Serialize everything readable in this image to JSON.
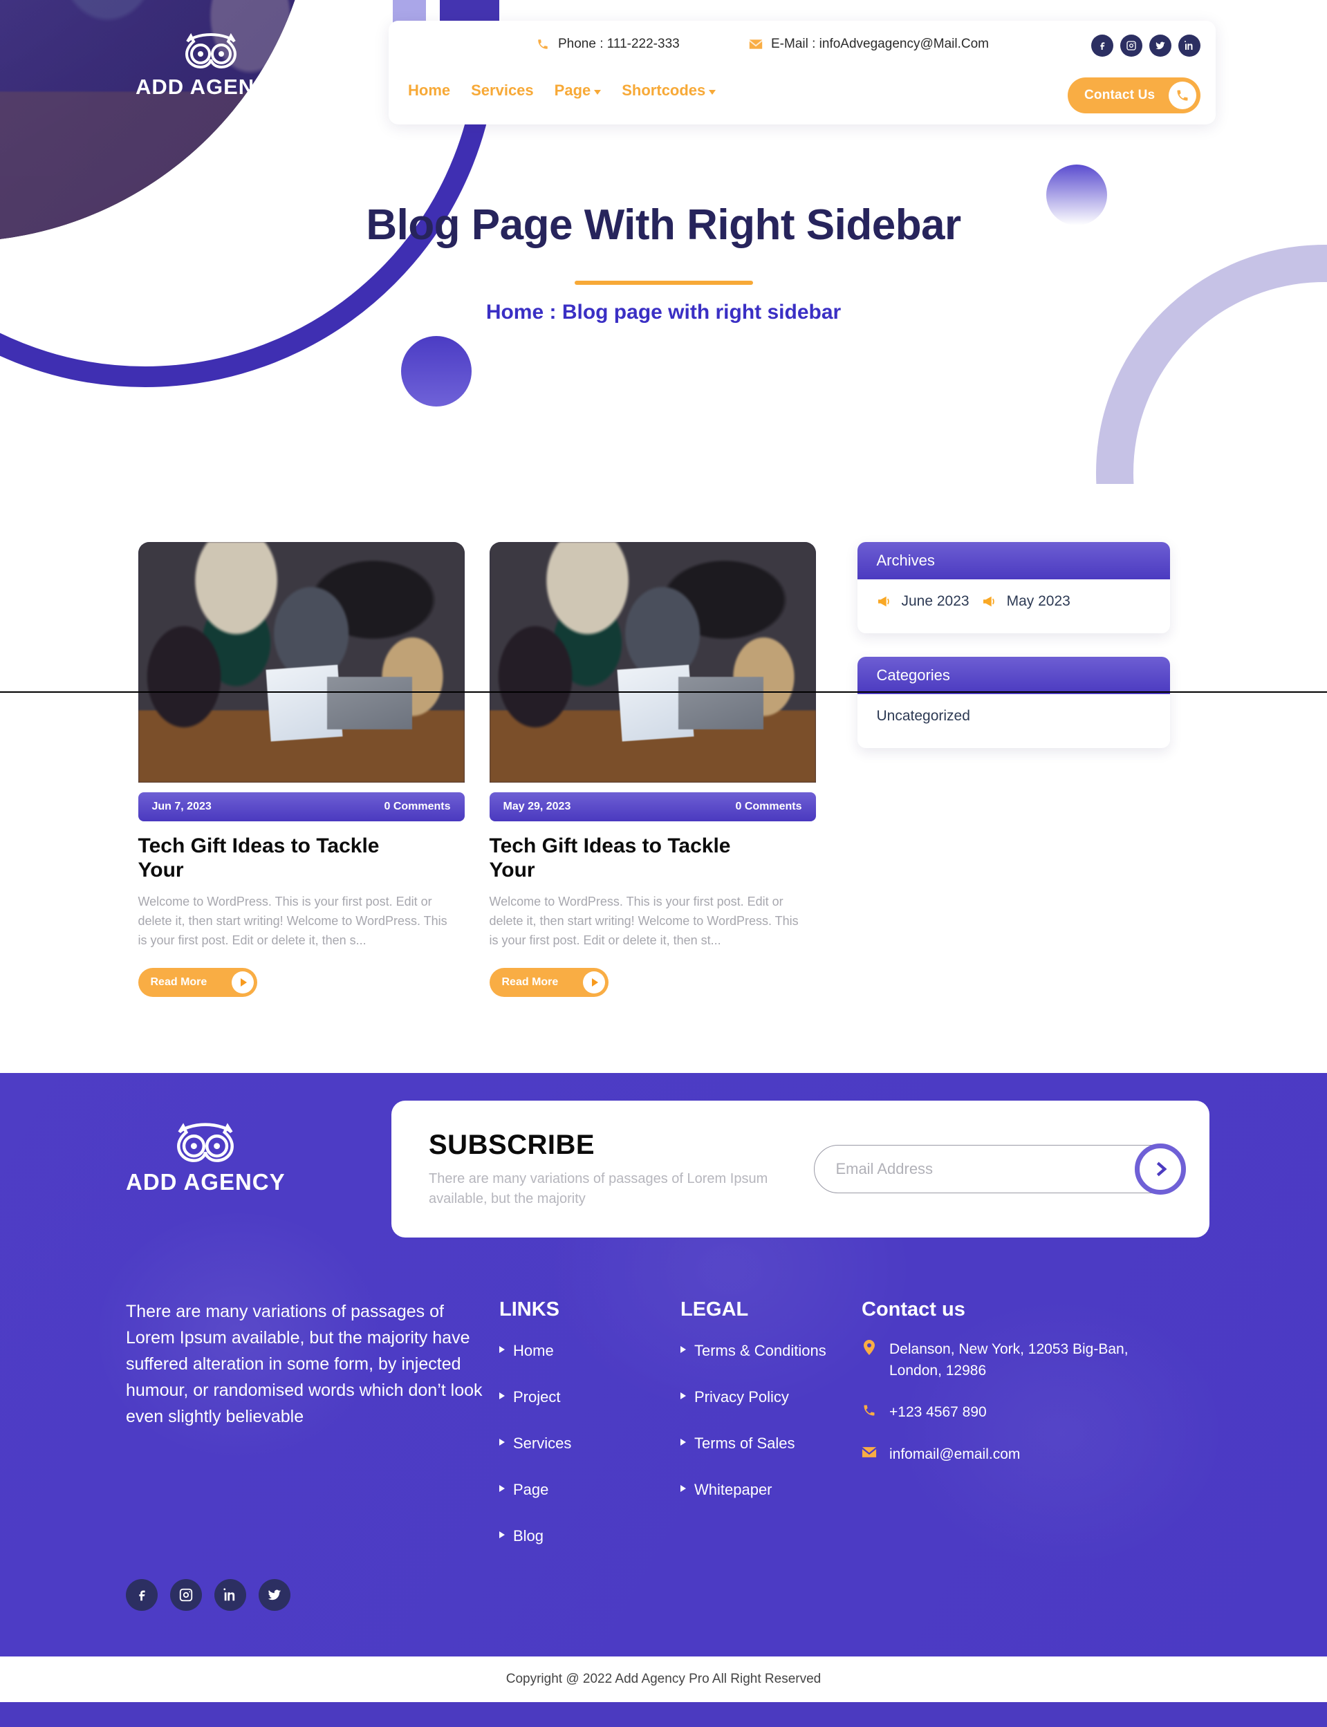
{
  "brand": {
    "name": "ADD AGENCY",
    "logo_icon": "owl-icon"
  },
  "topbar": {
    "phone_label": "Phone : 111-222-333",
    "email_label": "E-Mail : infoAdvegagency@Mail.Com",
    "phone_icon": "phone-icon",
    "email_icon": "envelope-icon",
    "socials": [
      {
        "name": "facebook-icon"
      },
      {
        "name": "instagram-icon"
      },
      {
        "name": "twitter-icon"
      },
      {
        "name": "linkedin-icon"
      }
    ]
  },
  "nav": {
    "items": [
      {
        "label": "Home",
        "has_dropdown": false
      },
      {
        "label": "Services",
        "has_dropdown": false
      },
      {
        "label": "Page",
        "has_dropdown": true
      },
      {
        "label": "Shortcodes",
        "has_dropdown": true
      }
    ],
    "contact_button": {
      "label": "Contact Us",
      "icon": "phone-icon"
    }
  },
  "hero": {
    "title": "Blog Page With Right Sidebar",
    "breadcrumb": "Home : Blog page with right sidebar"
  },
  "posts": [
    {
      "date": "Jun 7, 2023",
      "comments": "0 Comments",
      "title": "Tech Gift Ideas to Tackle Your",
      "excerpt": "Welcome to WordPress. This is your first post. Edit or delete it, then start writing! Welcome to WordPress. This is your first post. Edit or delete it, then s...",
      "read_more": "Read More"
    },
    {
      "date": "May 29, 2023",
      "comments": "0 Comments",
      "title": "Tech Gift Ideas to Tackle Your",
      "excerpt": "Welcome to WordPress. This is your first post. Edit or delete it, then start writing! Welcome to WordPress. This is your first post. Edit or delete it, then st...",
      "read_more": "Read More"
    }
  ],
  "sidebar": {
    "archives": {
      "title": "Archives",
      "items": [
        {
          "label": "June 2023"
        },
        {
          "label": "May 2023"
        }
      ]
    },
    "categories": {
      "title": "Categories",
      "items": [
        {
          "label": "Uncategorized"
        }
      ]
    }
  },
  "subscribe": {
    "title": "SUBSCRIBE",
    "description": "There are many variations of passages of Lorem Ipsum available, but the majority",
    "placeholder": "Email Address",
    "value": "",
    "submit_icon": "chevron-right-icon"
  },
  "footer": {
    "about": "There are many variations of passages of Lorem Ipsum available, but the majority have suffered alteration in some form, by injected humour, or randomised words which don’t look even slightly believable",
    "links": {
      "title": "LINKS",
      "items": [
        {
          "label": "Home"
        },
        {
          "label": "Project"
        },
        {
          "label": "Services"
        },
        {
          "label": "Page"
        },
        {
          "label": "Blog"
        }
      ]
    },
    "legal": {
      "title": "LEGAL",
      "items": [
        {
          "label": "Terms & Conditions"
        },
        {
          "label": "Privacy Policy"
        },
        {
          "label": "Terms of Sales"
        },
        {
          "label": "Whitepaper"
        }
      ]
    },
    "contact": {
      "title": "Contact us",
      "address": "Delanson, New York, 12053 Big-Ban, London, 12986",
      "phone": "+123 4567 890",
      "email": "infomail@email.com",
      "address_icon": "location-pin-icon",
      "phone_icon": "phone-icon",
      "email_icon": "envelope-icon"
    },
    "socials": [
      {
        "name": "facebook-icon"
      },
      {
        "name": "instagram-icon"
      },
      {
        "name": "linkedin-icon"
      },
      {
        "name": "twitter-icon"
      }
    ],
    "copyright": "Copyright @ 2022 Add Agency Pro All Right Reserved"
  },
  "colors": {
    "purple": "#4b3ac0",
    "purple_light": "#6d5ed3",
    "orange": "#f9ad44",
    "navy": "#27245c",
    "dark_social": "#2c2f62"
  }
}
